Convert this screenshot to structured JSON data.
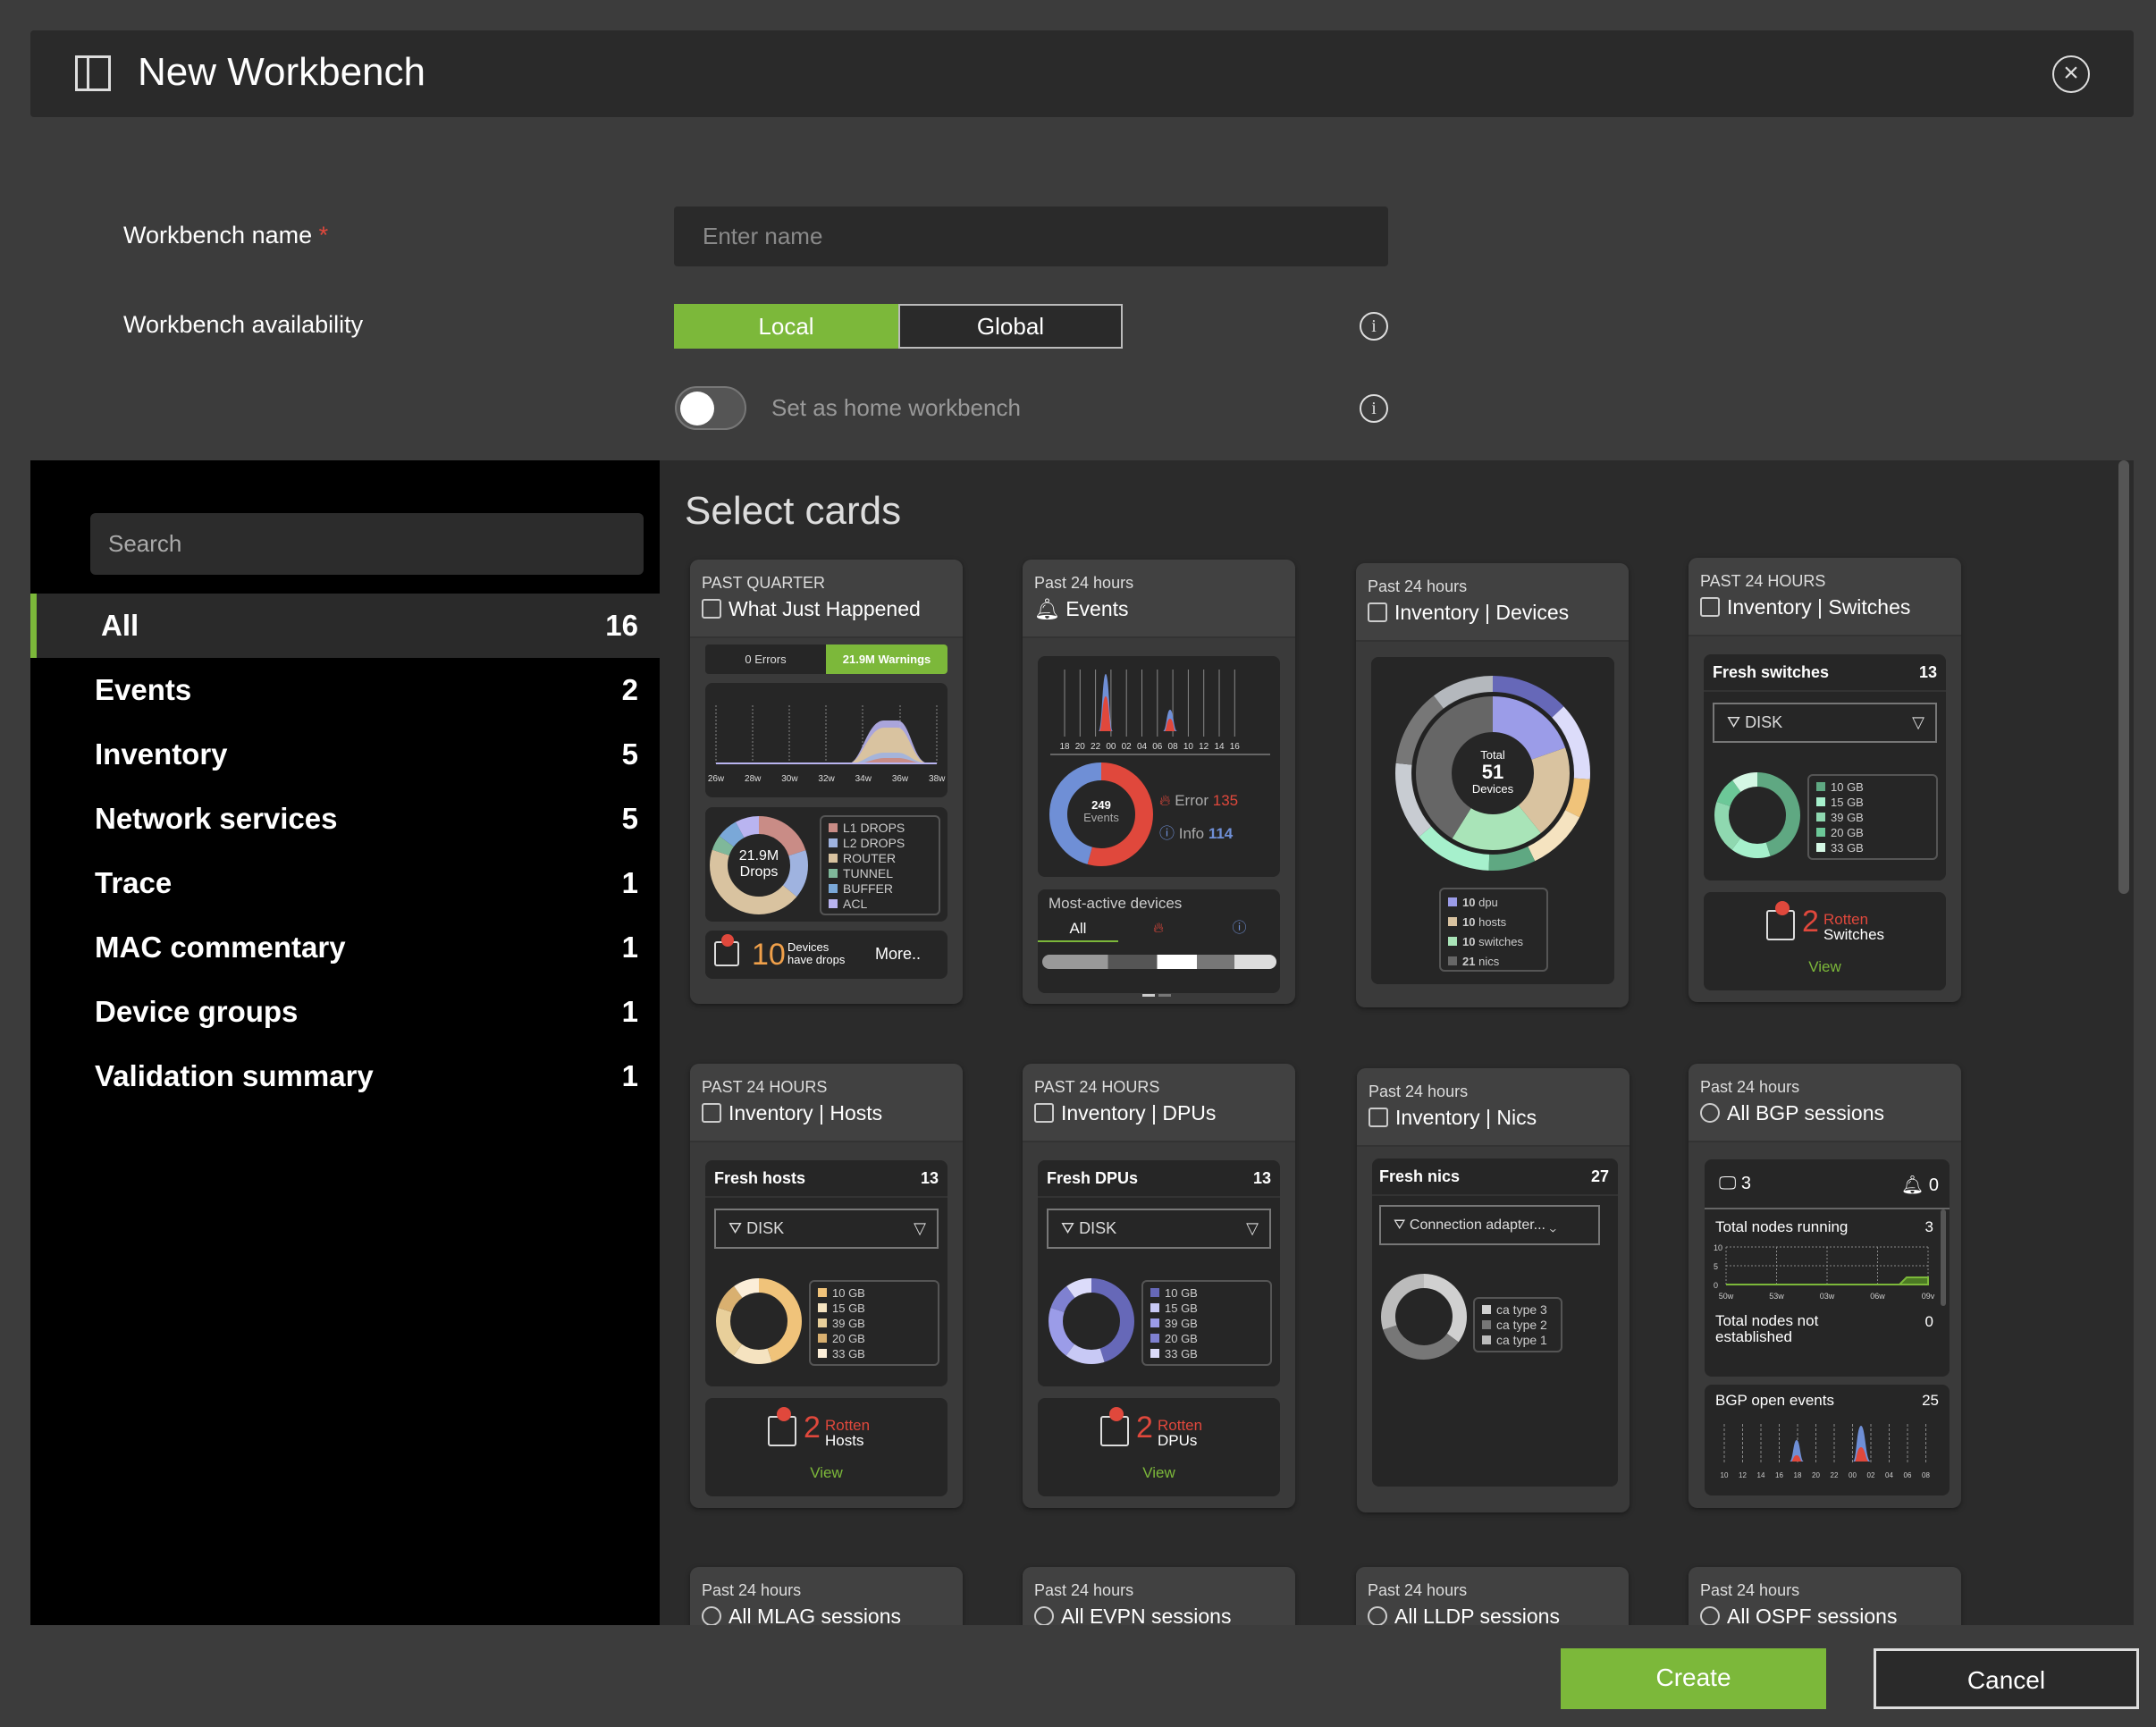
{
  "header": {
    "title": "New Workbench",
    "panel_icon": "sidebar-panel-icon",
    "close_icon": "close-circle-icon"
  },
  "form": {
    "name_label": "Workbench name",
    "required_mark": "*",
    "name_placeholder": "Enter name",
    "name_value": "",
    "availability_label": "Workbench availability",
    "options": [
      "Local",
      "Global"
    ],
    "selected": "Local",
    "home_label": "Set as home workbench",
    "home_on": false
  },
  "sidebar": {
    "search_placeholder": "Search",
    "items": [
      {
        "label": "All",
        "count": "16"
      },
      {
        "label": "Events",
        "count": "2"
      },
      {
        "label": "Inventory",
        "count": "5"
      },
      {
        "label": "Network services",
        "count": "5"
      },
      {
        "label": "Trace",
        "count": "1"
      },
      {
        "label": "MAC commentary",
        "count": "1"
      },
      {
        "label": "Device groups",
        "count": "1"
      },
      {
        "label": "Validation summary",
        "count": "1"
      }
    ]
  },
  "main": {
    "title": "Select cards"
  },
  "colors": {
    "accent": "#7cb83a",
    "error": "#e0483c",
    "info": "#6f8fd6",
    "bg": "#3c3c3c"
  },
  "cards": {
    "wjh": {
      "sub": "PAST QUARTER",
      "title": "What Just Happened",
      "errors": "0 Errors",
      "warnings": "21.9M Warnings",
      "ticks": [
        "26w",
        "28w",
        "30w",
        "32w",
        "34w",
        "36w",
        "38w"
      ],
      "donut_value": "21.9M",
      "donut_label": "Drops",
      "legend": [
        {
          "label": "L1 DROPS",
          "color": "#c98c86",
          "value": 20
        },
        {
          "label": "L2 DROPS",
          "color": "#9fb3e0",
          "value": 16
        },
        {
          "label": "ROUTER",
          "color": "#d9c3a0",
          "value": 44
        },
        {
          "label": "TUNNEL",
          "color": "#7fb89a",
          "value": 5
        },
        {
          "label": "BUFFER",
          "color": "#7aa8d8",
          "value": 7
        },
        {
          "label": "ACL",
          "color": "#b9b4f0",
          "value": 8
        }
      ],
      "count": "10",
      "count_text1": "Devices",
      "count_text2": "have drops",
      "more": "More.."
    },
    "events": {
      "sub": "Past 24 hours",
      "title": "Events",
      "ticks": [
        "18",
        "20",
        "22",
        "00",
        "02",
        "04",
        "06",
        "08",
        "10",
        "12",
        "14",
        "16"
      ],
      "total": "249",
      "total_label": "Events",
      "error_label": "Error",
      "error": "135",
      "info_label": "Info",
      "info": "114",
      "most_active": "Most-active devices",
      "tab_all": "All"
    },
    "devices": {
      "sub": "Past 24 hours",
      "title": "Inventory | Devices",
      "total_label": "Total",
      "total": "51",
      "unit": "Devices",
      "legend": [
        {
          "n": "10",
          "label": "dpu",
          "color": "#9b9ce8"
        },
        {
          "n": "10",
          "label": "hosts",
          "color": "#d9c3a0"
        },
        {
          "n": "10",
          "label": "switches",
          "color": "#a9e4b8"
        },
        {
          "n": "21",
          "label": "nics",
          "color": "#666666"
        }
      ]
    },
    "switches": {
      "sub": "PAST 24 HOURS",
      "title": "Inventory | Switches",
      "fresh": "Fresh switches",
      "fresh_n": "13",
      "filter": "DISK",
      "legend": [
        "10 GB",
        "15 GB",
        "39 GB",
        "20 GB",
        "33 GB"
      ],
      "colors": [
        "#5fa882",
        "#a6f0cc",
        "#8fd8b0",
        "#6cc898",
        "#d4f7e4"
      ],
      "rotten_n": "2",
      "rotten": "Rotten",
      "rotten_what": "Switches",
      "view": "View"
    },
    "hosts": {
      "sub": "PAST 24 HOURS",
      "title": "Inventory | Hosts",
      "fresh": "Fresh hosts",
      "fresh_n": "13",
      "filter": "DISK",
      "legend": [
        "10 GB",
        "15 GB",
        "39 GB",
        "20 GB",
        "33 GB"
      ],
      "colors": [
        "#f0c37a",
        "#f5e3c0",
        "#e8cf9a",
        "#d9b070",
        "#fbeed8"
      ],
      "rotten_n": "2",
      "rotten": "Rotten",
      "rotten_what": "Hosts",
      "view": "View"
    },
    "dpus": {
      "sub": "PAST 24 HOURS",
      "title": "Inventory | DPUs",
      "fresh": "Fresh DPUs",
      "fresh_n": "13",
      "filter": "DISK",
      "legend": [
        "10 GB",
        "15 GB",
        "39 GB",
        "20 GB",
        "33 GB"
      ],
      "colors": [
        "#6668b8",
        "#c8c9f5",
        "#9b9ce8",
        "#7f81d0",
        "#dcdcfa"
      ],
      "rotten_n": "2",
      "rotten": "Rotten",
      "rotten_what": "DPUs",
      "view": "View"
    },
    "nics": {
      "sub": "Past 24 hours",
      "title": "Inventory | Nics",
      "fresh": "Fresh nics",
      "fresh_n": "27",
      "filter": "Connection adapter...",
      "legend": [
        "ca type 3",
        "ca type 2",
        "ca type 1"
      ],
      "colors": [
        "#d0d0d0",
        "#777777",
        "#bbbbbb"
      ]
    },
    "bgp": {
      "sub": "Past 24 hours",
      "title": "All BGP sessions",
      "devices_n": "3",
      "alarms_n": "0",
      "running": "Total nodes running",
      "running_n": "3",
      "y_ticks": [
        "10",
        "5",
        "0"
      ],
      "x_ticks": [
        "50w",
        "53w",
        "03w",
        "06w",
        "09v"
      ],
      "not_est": "Total nodes not established",
      "not_est_n": "0",
      "open": "BGP open events",
      "open_n": "25",
      "open_ticks": [
        "10",
        "12",
        "14",
        "16",
        "18",
        "20",
        "22",
        "00",
        "02",
        "04",
        "06",
        "08"
      ]
    },
    "mlag": {
      "sub": "Past 24 hours",
      "title": "All MLAG sessions"
    },
    "evpn": {
      "sub": "Past 24 hours",
      "title": "All EVPN sessions"
    },
    "lldp": {
      "sub": "Past 24 hours",
      "title": "All LLDP sessions"
    },
    "ospf": {
      "sub": "Past 24 hours",
      "title": "All OSPF sessions"
    }
  },
  "footer": {
    "create": "Create",
    "cancel": "Cancel"
  }
}
